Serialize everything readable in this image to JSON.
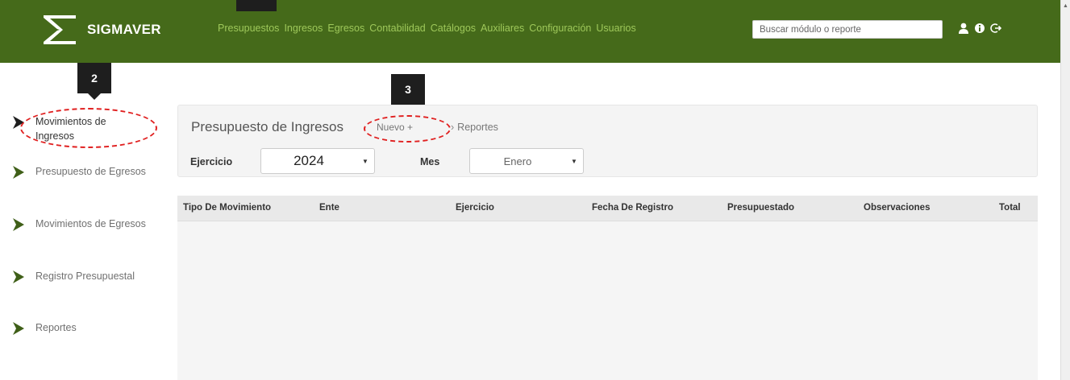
{
  "app": {
    "name": "SIGMAVER"
  },
  "nav": {
    "items": [
      "Presupuestos",
      "Ingresos",
      "Egresos",
      "Contabilidad",
      "Catálogos",
      "Auxiliares",
      "Configuración",
      "Usuarios"
    ]
  },
  "search": {
    "placeholder": "Buscar módulo o reporte"
  },
  "header_icons": [
    "user-icon",
    "info-icon",
    "logout-icon"
  ],
  "callouts": [
    "2",
    "3"
  ],
  "sidebar": {
    "items": [
      {
        "label": "Movimientos de Ingresos",
        "active": true
      },
      {
        "label": "Presupuesto de Egresos",
        "active": false
      },
      {
        "label": "Movimientos de Egresos",
        "active": false
      },
      {
        "label": "Registro Presupuestal",
        "active": false
      },
      {
        "label": "Reportes",
        "active": false
      }
    ]
  },
  "panel": {
    "title": "Presupuesto de Ingresos",
    "new_label": "Nuevo +",
    "reports_label": "Reportes",
    "ejercicio_label": "Ejercicio",
    "ejercicio_value": "2024",
    "mes_label": "Mes",
    "mes_value": "Enero"
  },
  "table": {
    "columns": [
      "Tipo De Movimiento",
      "Ente",
      "Ejercicio",
      "Fecha De Registro",
      "Presupuestado",
      "Observaciones",
      "Total"
    ],
    "rows": []
  },
  "colors": {
    "header_bg": "#456a1a",
    "nav_text": "#9ec85a",
    "accent_chevron": "#3f5f18",
    "callout_red": "#e02020"
  }
}
